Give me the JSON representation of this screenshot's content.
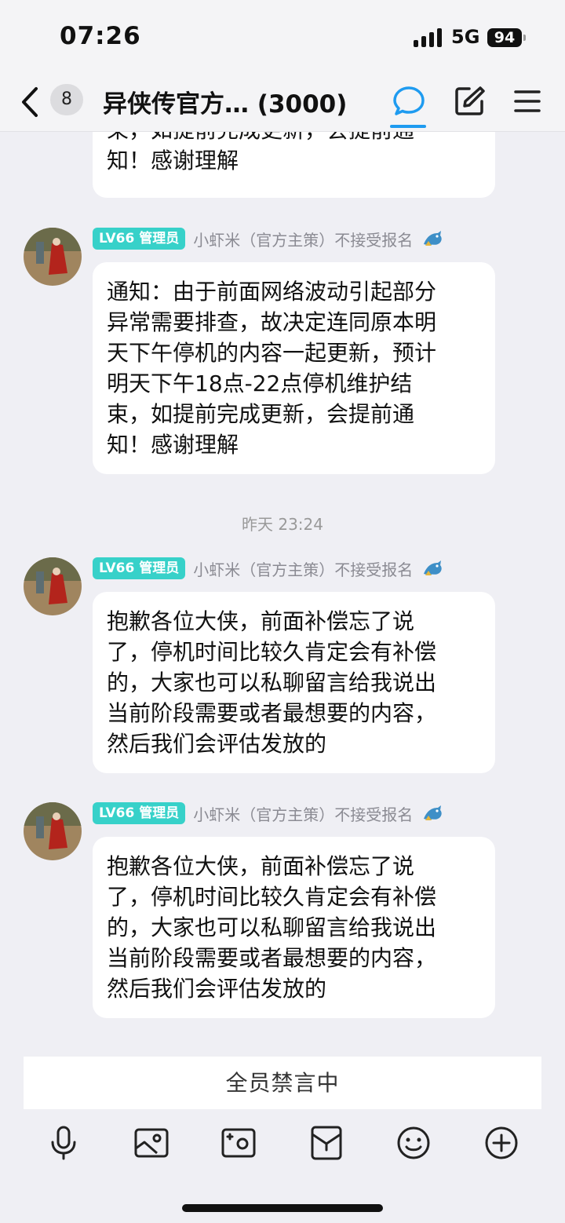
{
  "status_bar": {
    "time": "07:26",
    "network": "5G",
    "battery": "94"
  },
  "nav": {
    "unread_count": "8",
    "title": "异侠传官方… (3000)",
    "icons": [
      "back-chevron-icon",
      "chat-bubble-icon",
      "edit-icon",
      "menu-icon"
    ],
    "accent_color": "#1e9bf0"
  },
  "messages": {
    "partial_top": {
      "text": "束，如提前完成更新，会提前通\n知！感谢理解"
    },
    "msg1": {
      "level": "LV66",
      "role": "管理员",
      "sender": "小虾米（官方主策）不接受报名",
      "text": "通知：由于前面网络波动引起部分\n异常需要排查，故决定连同原本明\n天下午停机的内容一起更新，预计\n明天下午18点-22点停机维护结\n束，如提前完成更新，会提前通\n知！感谢理解"
    },
    "timestamp": "昨天 23:24",
    "msg2": {
      "level": "LV66",
      "role": "管理员",
      "sender": "小虾米（官方主策）不接受报名",
      "text": "抱歉各位大侠，前面补偿忘了说\n了，停机时间比较久肯定会有补偿\n的，大家也可以私聊留言给我说出\n当前阶段需要或者最想要的内容，\n然后我们会评估发放的"
    },
    "msg3": {
      "level": "LV66",
      "role": "管理员",
      "sender": "小虾米（官方主策）不接受报名",
      "text": "抱歉各位大侠，前面补偿忘了说\n了，停机时间比较久肯定会有补偿\n的，大家也可以私聊留言给我说出\n当前阶段需要或者最想要的内容，\n然后我们会评估发放的"
    },
    "badge_color": "#37d1c9"
  },
  "bottom": {
    "muted_text": "全员禁言中",
    "toolbar_icons": [
      "microphone-icon",
      "image-icon",
      "camera-icon",
      "red-packet-icon",
      "emoji-icon",
      "plus-icon"
    ]
  }
}
